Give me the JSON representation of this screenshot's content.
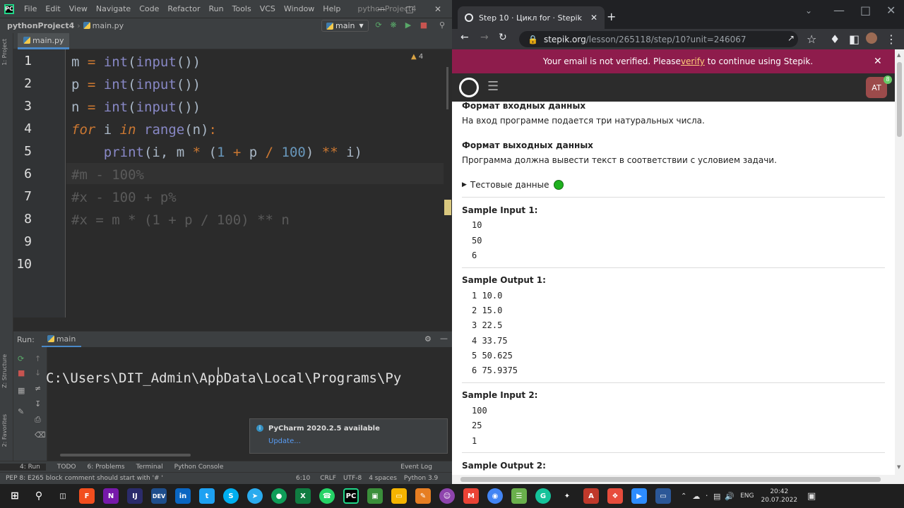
{
  "pycharm": {
    "menu": [
      "File",
      "Edit",
      "View",
      "Navigate",
      "Code",
      "Refactor",
      "Run",
      "Tools",
      "VCS",
      "Window",
      "Help"
    ],
    "project_title": "pythonProject4",
    "breadcrumb_project": "pythonProject4",
    "breadcrumb_file": "main.py",
    "run_config": "main",
    "editor_tab": "main.py",
    "warnings_count": "4",
    "line_numbers": [
      "1",
      "2",
      "3",
      "4",
      "5",
      "6",
      "7",
      "8",
      "9",
      "10"
    ],
    "code_lines": [
      "m = int(input())",
      "p = int(input())",
      "n = int(input())",
      "for i in range(n):",
      "    print(i, m * (1 + p / 100) ** i)",
      "#m - 100%",
      "#x - 100 + p%",
      "#x = m * (1 + p / 100) ** n"
    ],
    "run_label": "Run:",
    "run_tab": "main",
    "run_output": "C:\\Users\\DIT_Admin\\AppData\\Local\\Programs\\Py",
    "notification_title": "PyCharm 2020.2.5 available",
    "notification_link": "Update...",
    "left_strip_labels": [
      "1: Project",
      "Z: Structure",
      "2: Favorites"
    ],
    "bottom_tools": [
      "4: Run",
      "TODO",
      "6: Problems",
      "Terminal",
      "Python Console",
      "Event Log"
    ],
    "status_message": "PEP 8: E265 block comment should start with '# '",
    "status_pos": "6:10",
    "status_crlf": "CRLF",
    "status_enc": "UTF-8",
    "status_indent": "4 spaces",
    "status_interp": "Python 3.9"
  },
  "chrome": {
    "tab_title": "Step 10 · Цикл for · Stepik",
    "url_domain": "stepik.org",
    "url_path": "/lesson/265118/step/10?unit=246067",
    "banner_pre": "Your email is not verified. Please ",
    "banner_link": "verify",
    "banner_post": " to continue using Stepik.",
    "avatar": "AT",
    "avatar_badge": "8",
    "input_format_title": "Формат входных данных",
    "input_format_text": "На вход программе подается три натуральных числа.",
    "output_format_title": "Формат выходных данных",
    "output_format_text": "Программа должна вывести текст в соответствии с условием задачи.",
    "test_data_label": "Тестовые данные",
    "sample_input_1_title": "Sample Input 1:",
    "sample_input_1": [
      "10",
      "50",
      "6"
    ],
    "sample_output_1_title": "Sample Output 1:",
    "sample_output_1": [
      "1 10.0",
      "2 15.0",
      "3 22.5",
      "4 33.75",
      "5 50.625",
      "6 75.9375"
    ],
    "sample_input_2_title": "Sample Input 2:",
    "sample_input_2": [
      "100",
      "25",
      "1"
    ],
    "sample_output_2_title": "Sample Output 2:"
  },
  "taskbar": {
    "lang": "ENG",
    "time": "20:42",
    "date": "20.07.2022"
  },
  "colors": {
    "pycharm_bg": "#2b2b2b",
    "banner": "#8e1c4c",
    "keyword": "#cc7832",
    "number": "#6897bb",
    "builtin": "#8888c6"
  }
}
